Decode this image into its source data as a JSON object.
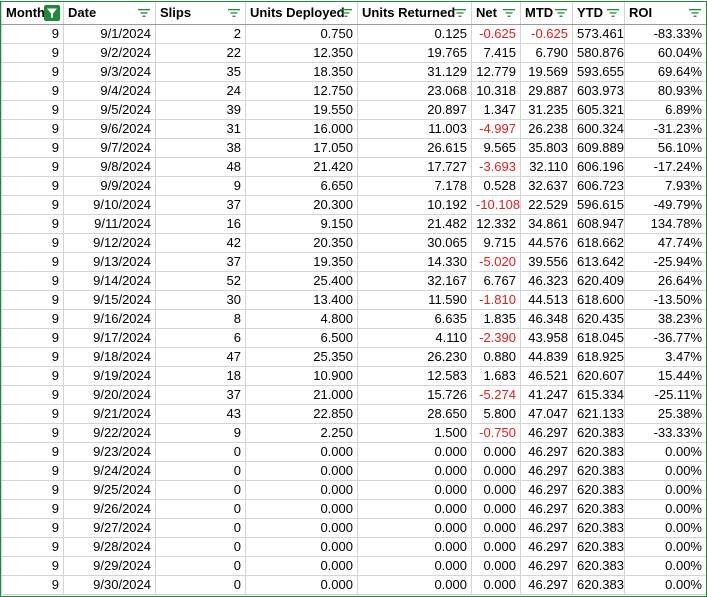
{
  "columns": [
    {
      "label": "Month",
      "filter_active": true
    },
    {
      "label": "Date",
      "filter_active": false
    },
    {
      "label": "Slips",
      "filter_active": false
    },
    {
      "label": "Units Deployed",
      "filter_active": false
    },
    {
      "label": "Units Returned",
      "filter_active": false
    },
    {
      "label": "Net",
      "filter_active": false
    },
    {
      "label": "MTD",
      "filter_active": false
    },
    {
      "label": "YTD",
      "filter_active": false
    },
    {
      "label": "ROI",
      "filter_active": false
    }
  ],
  "colors": {
    "negative": "#e0201a",
    "filter_active_bg": "#1f8b3a",
    "frame": "#1f8b3a",
    "gridline": "#d4d4d4"
  },
  "rows": [
    {
      "month": "9",
      "date": "9/1/2024",
      "slips": "2",
      "units_deployed": "0.750",
      "units_returned": "0.125",
      "net": "-0.625",
      "mtd": "-0.625",
      "ytd": "573.461",
      "roi": "-83.33%"
    },
    {
      "month": "9",
      "date": "9/2/2024",
      "slips": "22",
      "units_deployed": "12.350",
      "units_returned": "19.765",
      "net": "7.415",
      "mtd": "6.790",
      "ytd": "580.876",
      "roi": "60.04%"
    },
    {
      "month": "9",
      "date": "9/3/2024",
      "slips": "35",
      "units_deployed": "18.350",
      "units_returned": "31.129",
      "net": "12.779",
      "mtd": "19.569",
      "ytd": "593.655",
      "roi": "69.64%"
    },
    {
      "month": "9",
      "date": "9/4/2024",
      "slips": "24",
      "units_deployed": "12.750",
      "units_returned": "23.068",
      "net": "10.318",
      "mtd": "29.887",
      "ytd": "603.973",
      "roi": "80.93%"
    },
    {
      "month": "9",
      "date": "9/5/2024",
      "slips": "39",
      "units_deployed": "19.550",
      "units_returned": "20.897",
      "net": "1.347",
      "mtd": "31.235",
      "ytd": "605.321",
      "roi": "6.89%"
    },
    {
      "month": "9",
      "date": "9/6/2024",
      "slips": "31",
      "units_deployed": "16.000",
      "units_returned": "11.003",
      "net": "-4.997",
      "mtd": "26.238",
      "ytd": "600.324",
      "roi": "-31.23%"
    },
    {
      "month": "9",
      "date": "9/7/2024",
      "slips": "38",
      "units_deployed": "17.050",
      "units_returned": "26.615",
      "net": "9.565",
      "mtd": "35.803",
      "ytd": "609.889",
      "roi": "56.10%"
    },
    {
      "month": "9",
      "date": "9/8/2024",
      "slips": "48",
      "units_deployed": "21.420",
      "units_returned": "17.727",
      "net": "-3.693",
      "mtd": "32.110",
      "ytd": "606.196",
      "roi": "-17.24%"
    },
    {
      "month": "9",
      "date": "9/9/2024",
      "slips": "9",
      "units_deployed": "6.650",
      "units_returned": "7.178",
      "net": "0.528",
      "mtd": "32.637",
      "ytd": "606.723",
      "roi": "7.93%"
    },
    {
      "month": "9",
      "date": "9/10/2024",
      "slips": "37",
      "units_deployed": "20.300",
      "units_returned": "10.192",
      "net": "-10.108",
      "mtd": "22.529",
      "ytd": "596.615",
      "roi": "-49.79%"
    },
    {
      "month": "9",
      "date": "9/11/2024",
      "slips": "16",
      "units_deployed": "9.150",
      "units_returned": "21.482",
      "net": "12.332",
      "mtd": "34.861",
      "ytd": "608.947",
      "roi": "134.78%"
    },
    {
      "month": "9",
      "date": "9/12/2024",
      "slips": "42",
      "units_deployed": "20.350",
      "units_returned": "30.065",
      "net": "9.715",
      "mtd": "44.576",
      "ytd": "618.662",
      "roi": "47.74%"
    },
    {
      "month": "9",
      "date": "9/13/2024",
      "slips": "37",
      "units_deployed": "19.350",
      "units_returned": "14.330",
      "net": "-5.020",
      "mtd": "39.556",
      "ytd": "613.642",
      "roi": "-25.94%"
    },
    {
      "month": "9",
      "date": "9/14/2024",
      "slips": "52",
      "units_deployed": "25.400",
      "units_returned": "32.167",
      "net": "6.767",
      "mtd": "46.323",
      "ytd": "620.409",
      "roi": "26.64%"
    },
    {
      "month": "9",
      "date": "9/15/2024",
      "slips": "30",
      "units_deployed": "13.400",
      "units_returned": "11.590",
      "net": "-1.810",
      "mtd": "44.513",
      "ytd": "618.600",
      "roi": "-13.50%"
    },
    {
      "month": "9",
      "date": "9/16/2024",
      "slips": "8",
      "units_deployed": "4.800",
      "units_returned": "6.635",
      "net": "1.835",
      "mtd": "46.348",
      "ytd": "620.435",
      "roi": "38.23%"
    },
    {
      "month": "9",
      "date": "9/17/2024",
      "slips": "6",
      "units_deployed": "6.500",
      "units_returned": "4.110",
      "net": "-2.390",
      "mtd": "43.958",
      "ytd": "618.045",
      "roi": "-36.77%"
    },
    {
      "month": "9",
      "date": "9/18/2024",
      "slips": "47",
      "units_deployed": "25.350",
      "units_returned": "26.230",
      "net": "0.880",
      "mtd": "44.839",
      "ytd": "618.925",
      "roi": "3.47%"
    },
    {
      "month": "9",
      "date": "9/19/2024",
      "slips": "18",
      "units_deployed": "10.900",
      "units_returned": "12.583",
      "net": "1.683",
      "mtd": "46.521",
      "ytd": "620.607",
      "roi": "15.44%"
    },
    {
      "month": "9",
      "date": "9/20/2024",
      "slips": "37",
      "units_deployed": "21.000",
      "units_returned": "15.726",
      "net": "-5.274",
      "mtd": "41.247",
      "ytd": "615.334",
      "roi": "-25.11%"
    },
    {
      "month": "9",
      "date": "9/21/2024",
      "slips": "43",
      "units_deployed": "22.850",
      "units_returned": "28.650",
      "net": "5.800",
      "mtd": "47.047",
      "ytd": "621.133",
      "roi": "25.38%"
    },
    {
      "month": "9",
      "date": "9/22/2024",
      "slips": "9",
      "units_deployed": "2.250",
      "units_returned": "1.500",
      "net": "-0.750",
      "mtd": "46.297",
      "ytd": "620.383",
      "roi": "-33.33%"
    },
    {
      "month": "9",
      "date": "9/23/2024",
      "slips": "0",
      "units_deployed": "0.000",
      "units_returned": "0.000",
      "net": "0.000",
      "mtd": "46.297",
      "ytd": "620.383",
      "roi": "0.00%"
    },
    {
      "month": "9",
      "date": "9/24/2024",
      "slips": "0",
      "units_deployed": "0.000",
      "units_returned": "0.000",
      "net": "0.000",
      "mtd": "46.297",
      "ytd": "620.383",
      "roi": "0.00%"
    },
    {
      "month": "9",
      "date": "9/25/2024",
      "slips": "0",
      "units_deployed": "0.000",
      "units_returned": "0.000",
      "net": "0.000",
      "mtd": "46.297",
      "ytd": "620.383",
      "roi": "0.00%"
    },
    {
      "month": "9",
      "date": "9/26/2024",
      "slips": "0",
      "units_deployed": "0.000",
      "units_returned": "0.000",
      "net": "0.000",
      "mtd": "46.297",
      "ytd": "620.383",
      "roi": "0.00%"
    },
    {
      "month": "9",
      "date": "9/27/2024",
      "slips": "0",
      "units_deployed": "0.000",
      "units_returned": "0.000",
      "net": "0.000",
      "mtd": "46.297",
      "ytd": "620.383",
      "roi": "0.00%"
    },
    {
      "month": "9",
      "date": "9/28/2024",
      "slips": "0",
      "units_deployed": "0.000",
      "units_returned": "0.000",
      "net": "0.000",
      "mtd": "46.297",
      "ytd": "620.383",
      "roi": "0.00%"
    },
    {
      "month": "9",
      "date": "9/29/2024",
      "slips": "0",
      "units_deployed": "0.000",
      "units_returned": "0.000",
      "net": "0.000",
      "mtd": "46.297",
      "ytd": "620.383",
      "roi": "0.00%"
    },
    {
      "month": "9",
      "date": "9/30/2024",
      "slips": "0",
      "units_deployed": "0.000",
      "units_returned": "0.000",
      "net": "0.000",
      "mtd": "46.297",
      "ytd": "620.383",
      "roi": "0.00%"
    }
  ]
}
